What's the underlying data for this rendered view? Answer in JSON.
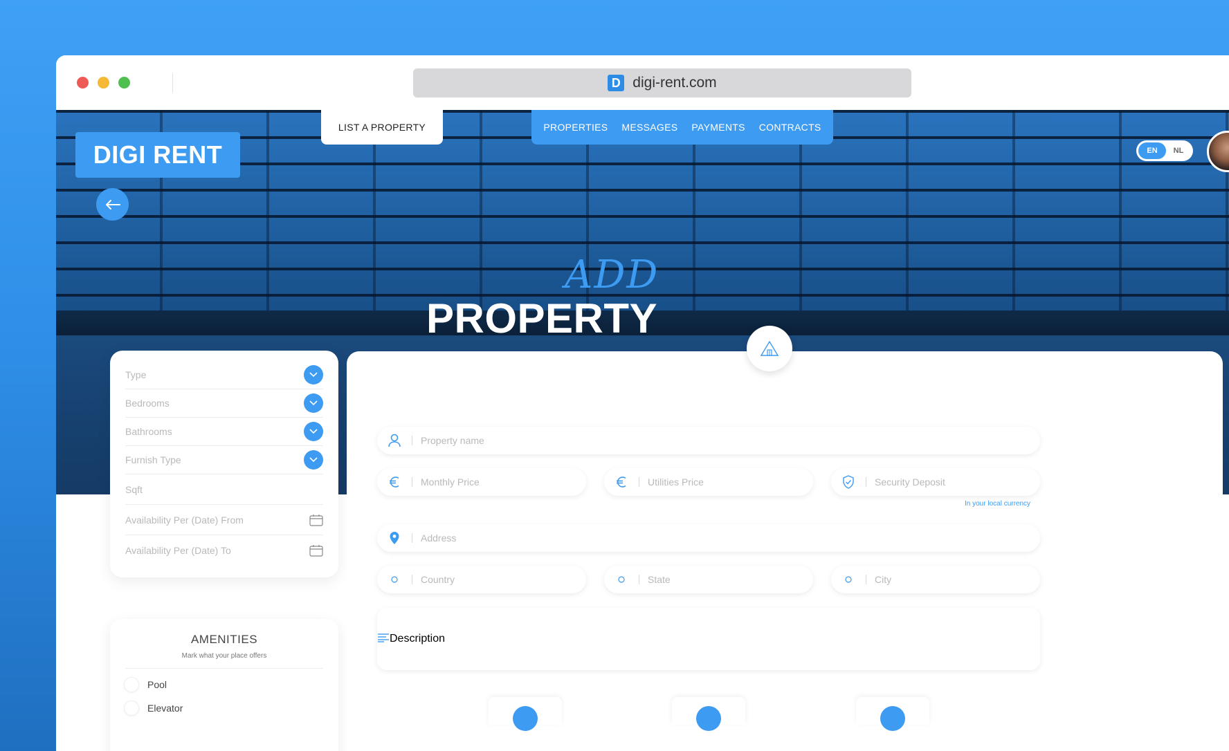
{
  "browser": {
    "url": "digi-rent.com",
    "favicon_letter": "D"
  },
  "brand": {
    "logo": "DIGI RENT",
    "accent_color": "#3d9bf2"
  },
  "nav": {
    "list_property": "LIST A PROPERTY",
    "links": [
      "PROPERTIES",
      "MESSAGES",
      "PAYMENTS",
      "CONTRACTS"
    ]
  },
  "lang": {
    "active": "EN",
    "other": "NL"
  },
  "hero": {
    "title_script": "ADD",
    "title": "PROPERTY"
  },
  "filters": {
    "type": "Type",
    "bedrooms": "Bedrooms",
    "bathrooms": "Bathrooms",
    "furnish": "Furnish Type",
    "sqft": "Sqft",
    "avail_from": "Availability Per (Date) From",
    "avail_to": "Availability Per (Date) To"
  },
  "amenities": {
    "title": "AMENITIES",
    "subtitle": "Mark what your place offers",
    "items": [
      "Pool",
      "Elevator"
    ]
  },
  "form": {
    "property_name": "Property name",
    "monthly_price": "Monthly Price",
    "utilities_price": "Utilities Price",
    "security_deposit": "Security Deposit",
    "currency_hint": "In your local currency",
    "address": "Address",
    "country": "Country",
    "state": "State",
    "city": "City",
    "description": "Description"
  },
  "icons": {
    "back": "arrow-left-icon",
    "house": "house-icon",
    "user": "user-icon",
    "euro": "euro-icon",
    "shield": "shield-icon",
    "pin": "location-pin-icon",
    "lines": "text-lines-icon",
    "calendar": "calendar-icon",
    "chevron": "chevron-down-icon"
  }
}
